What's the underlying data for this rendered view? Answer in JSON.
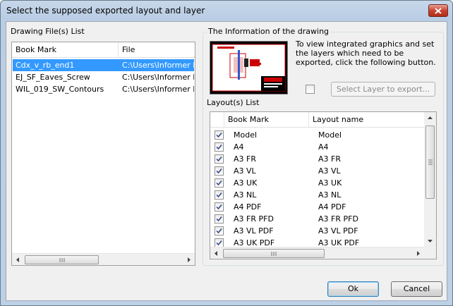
{
  "window": {
    "title": "Select the supposed exported layout and layer"
  },
  "files_panel": {
    "label": "Drawing File(s) List",
    "columns": [
      "Book Mark",
      "File"
    ],
    "rows": [
      {
        "bookmark": "Cdx_v_rb_end1",
        "file": "C:\\Users\\Informer IC",
        "selected": true
      },
      {
        "bookmark": "EJ_SF_Eaves_Screw",
        "file": "C:\\Users\\Informer IC",
        "selected": false
      },
      {
        "bookmark": "WIL_019_SW_Contours",
        "file": "C:\\Users\\Informer IC",
        "selected": false
      }
    ]
  },
  "info_panel": {
    "label": "The Information of the drawing",
    "description": "To view integrated graphics and set the layers which need to be exported, click the following button.",
    "select_layer_button": "Select Layer to export...",
    "select_layer_checked": false
  },
  "layouts_panel": {
    "label": "Layout(s) List",
    "columns": [
      "Book Mark",
      "Layout name"
    ],
    "rows": [
      {
        "bookmark": "Model",
        "layout": "Model",
        "checked": true
      },
      {
        "bookmark": "A4",
        "layout": "A4",
        "checked": true
      },
      {
        "bookmark": "A3 FR",
        "layout": "A3 FR",
        "checked": true
      },
      {
        "bookmark": "A3 VL",
        "layout": "A3 VL",
        "checked": true
      },
      {
        "bookmark": "A3 UK",
        "layout": "A3 UK",
        "checked": true
      },
      {
        "bookmark": "A3 NL",
        "layout": "A3 NL",
        "checked": true
      },
      {
        "bookmark": "A4 PDF",
        "layout": "A4 PDF",
        "checked": true
      },
      {
        "bookmark": "A3 FR PFD",
        "layout": "A3 FR PFD",
        "checked": true
      },
      {
        "bookmark": "A3 VL PDF",
        "layout": "A3 VL PDF",
        "checked": true
      },
      {
        "bookmark": "A3 UK PDF",
        "layout": "A3 UK PDF",
        "checked": true
      }
    ]
  },
  "footer": {
    "ok": "Ok",
    "cancel": "Cancel"
  },
  "colors": {
    "selection": "#3399ff",
    "preview_red": "#cc1111"
  },
  "icons": {
    "close": "close-icon",
    "check": "check-icon",
    "grip": "scroll-grip-icon"
  }
}
